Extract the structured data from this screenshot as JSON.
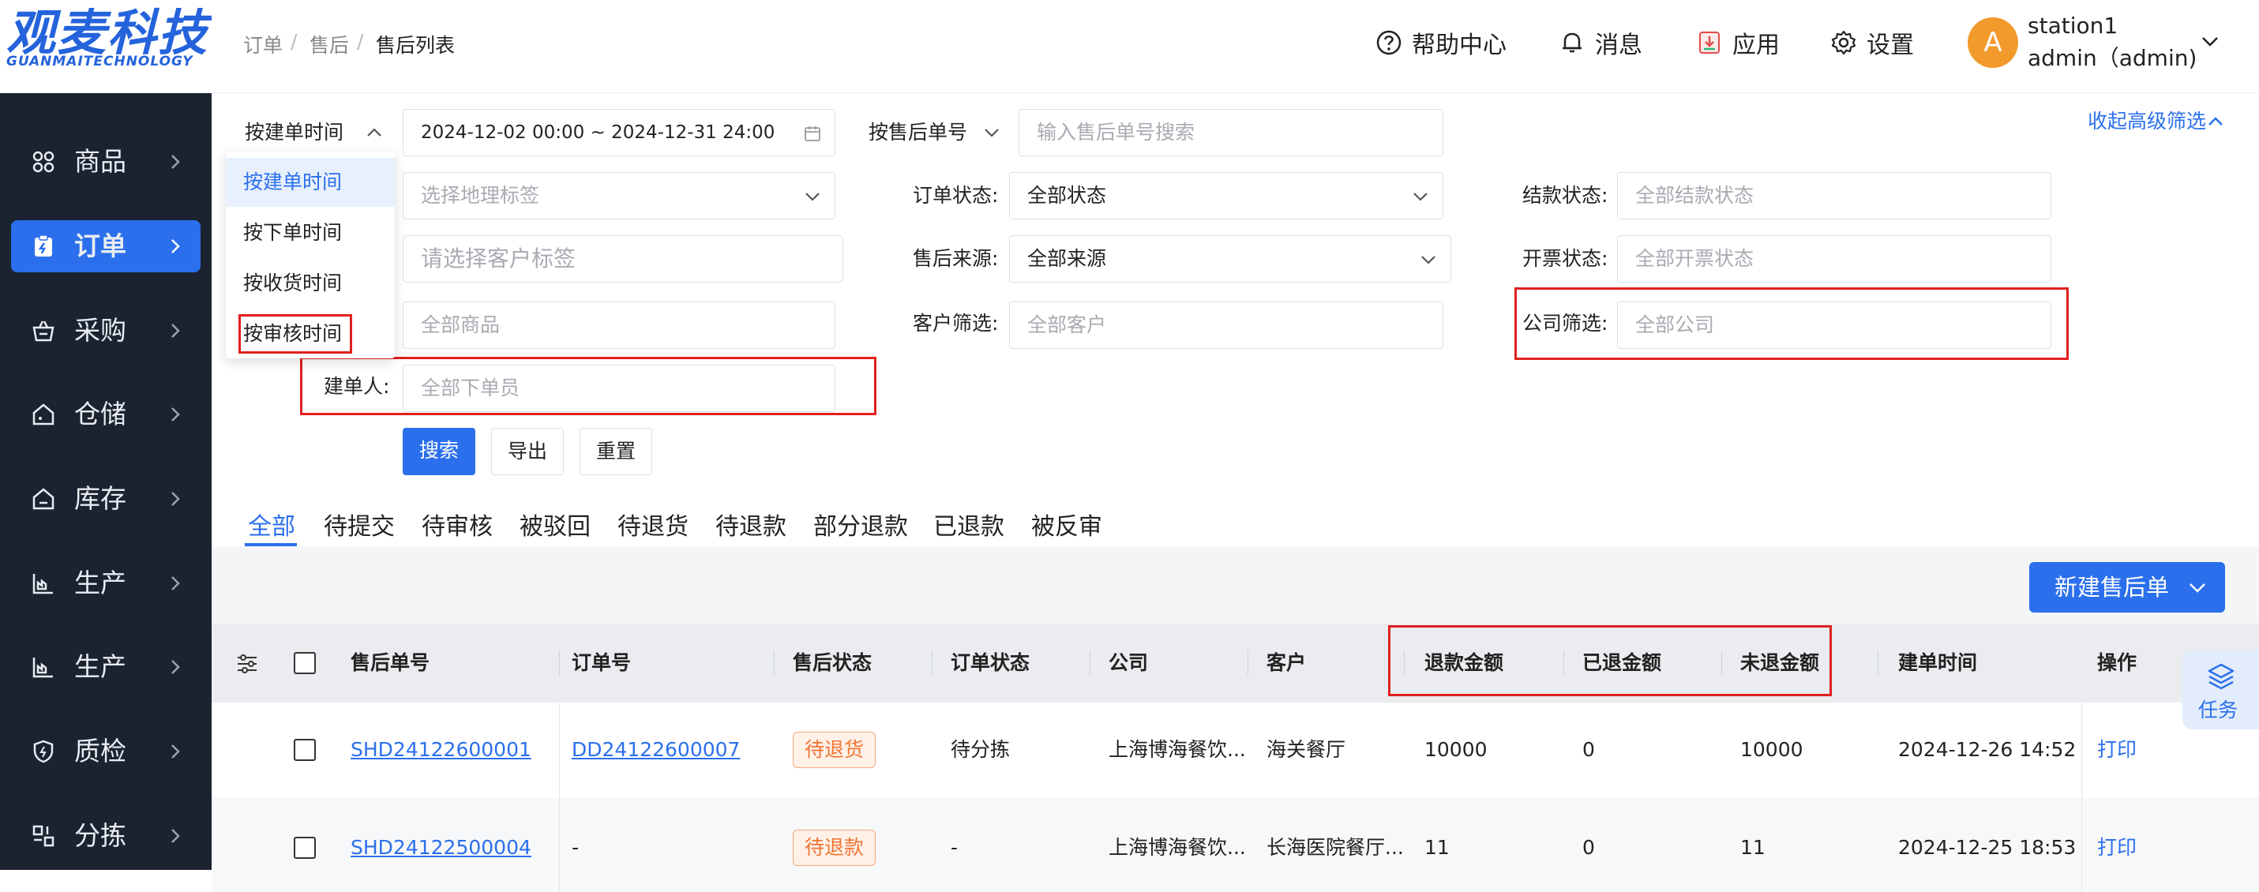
{
  "logo": {
    "text": "观麦科技",
    "sub": "GUANMAITECHNOLOGY"
  },
  "sidebar": {
    "items": [
      {
        "label": "商品",
        "icon": "grid-icon"
      },
      {
        "label": "订单",
        "icon": "clipboard-icon",
        "active": true
      },
      {
        "label": "采购",
        "icon": "basket-icon"
      },
      {
        "label": "仓储",
        "icon": "warehouse-icon"
      },
      {
        "label": "库存",
        "icon": "inventory-icon"
      },
      {
        "label": "生产",
        "icon": "factory-icon"
      },
      {
        "label": "生产",
        "icon": "factory-icon"
      },
      {
        "label": "质检",
        "icon": "shield-icon"
      },
      {
        "label": "分拣",
        "icon": "sort-icon"
      }
    ]
  },
  "breadcrumb": {
    "items": [
      "订单",
      "售后",
      "售后列表"
    ],
    "sep": "/"
  },
  "header": {
    "help": "帮助中心",
    "messages": "消息",
    "apps": "应用",
    "settings": "设置",
    "user": {
      "avatar": "A",
      "name": "station1",
      "role": "admin（admin)"
    }
  },
  "filters": {
    "time_type": "按建单时间",
    "date_range": "2024-12-02 00:00 ~ 2024-12-31 24:00",
    "time_options": [
      "按建单时间",
      "按下单时间",
      "按收货时间",
      "按审核时间"
    ],
    "aftersale_no_type": "按售后单号",
    "aftersale_no_placeholder": "输入售后单号搜索",
    "collapse": "收起高级筛选",
    "geo_placeholder": "选择地理标签",
    "customer_tag_placeholder": "请选择客户标签",
    "goods_placeholder": "全部商品",
    "creator_label": "建单人:",
    "creator_placeholder": "全部下单员",
    "order_status_label": "订单状态:",
    "order_status_value": "全部状态",
    "source_label": "售后来源:",
    "source_value": "全部来源",
    "customer_label": "客户筛选:",
    "customer_placeholder": "全部客户",
    "settle_label": "结款状态:",
    "settle_placeholder": "全部结款状态",
    "invoice_label": "开票状态:",
    "invoice_placeholder": "全部开票状态",
    "company_label": "公司筛选:",
    "company_placeholder": "全部公司"
  },
  "buttons": {
    "search": "搜索",
    "export": "导出",
    "reset": "重置",
    "new": "新建售后单"
  },
  "tabs": [
    "全部",
    "待提交",
    "待审核",
    "被驳回",
    "待退货",
    "待退款",
    "部分退款",
    "已退款",
    "被反审"
  ],
  "table": {
    "columns": [
      "售后单号",
      "订单号",
      "售后状态",
      "订单状态",
      "公司",
      "客户",
      "退款金额",
      "已退金额",
      "未退金额",
      "建单时间",
      "操作"
    ],
    "rows": [
      {
        "id": "SHD24122600001",
        "order": "DD24122600007",
        "status": "待退货",
        "order_status": "待分拣",
        "company": "上海博海餐饮...",
        "customer": "海关餐厅",
        "refund": "10000",
        "refunded": "0",
        "unrefunded": "10000",
        "created": "2024-12-26 14:52",
        "action": "打印"
      },
      {
        "id": "SHD24122500004",
        "order": "-",
        "status": "待退款",
        "order_status": "-",
        "company": "上海博海餐饮...",
        "customer": "长海医院餐厅...",
        "refund": "11",
        "refunded": "0",
        "unrefunded": "11",
        "created": "2024-12-25 18:53",
        "action": "打印"
      }
    ]
  },
  "float": {
    "task": "任务"
  },
  "colors": {
    "primary": "#2b6fec",
    "sidebar": "#1b2330",
    "highlight": "#e0201f",
    "badge": "#f07534"
  }
}
